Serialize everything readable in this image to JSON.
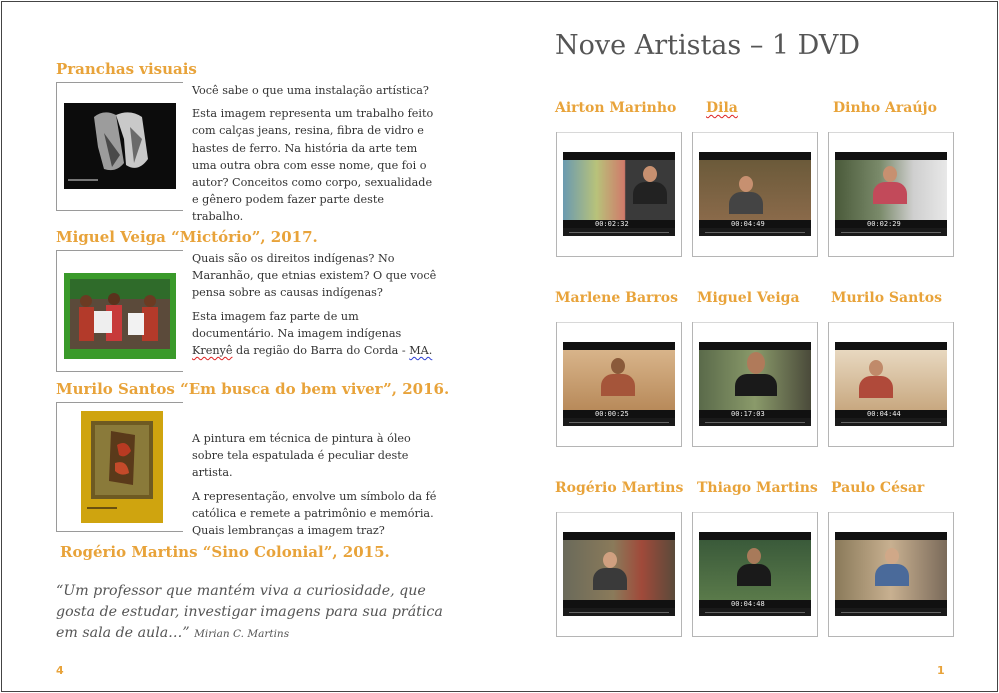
{
  "left_page": {
    "section1": {
      "heading": "Pranchas visuais",
      "p1": "Você sabe o que uma instalação artística?",
      "p2": "Esta imagem representa um trabalho feito com calças jeans, resina, fibra de vidro e hastes de ferro. Na história da arte tem uma outra obra com esse nome, que foi o autor? Conceitos como corpo, sexualidade e gênero podem fazer parte deste trabalho."
    },
    "section2": {
      "heading": "Miguel Veiga “Mictório”, 2017.",
      "p1": "Quais são os direitos indígenas? No Maranhão, que etnias existem? O que você pensa sobre as causas indígenas?",
      "p2_a": "Esta imagem faz parte de um documentário. Na imagem indígenas ",
      "p2_krenye": "Krenyê",
      "p2_b": " da região do Barra do Corda - ",
      "p2_ma": "MA."
    },
    "section3": {
      "heading": "Murilo Santos “Em busca do bem viver”, 2016.",
      "p1": "A pintura em técnica de pintura à óleo sobre tela espatulada é peculiar deste artista.",
      "p2": "A representação, envolve um símbolo da fé católica e remete a patrimônio e memória. Quais lembranças a imagem traz?"
    },
    "section4": {
      "heading": "Rogério Martins “Sino Colonial”, 2015."
    },
    "quote": {
      "text": "“Um professor que mantém viva a curiosidade, que gosta de estudar, investigar imagens para sua prática em sala de aula…”",
      "author": "Mirian C. Martins"
    },
    "page_number": "4"
  },
  "right_page": {
    "title": "Nove Artistas – 1 DVD",
    "artists": [
      {
        "name": "Airton Marinho",
        "timecode": "00:02:32"
      },
      {
        "name": "Dila",
        "timecode": "00:04:49"
      },
      {
        "name": "Dinho Araújo",
        "timecode": "00:02:29"
      },
      {
        "name": "Marlene Barros",
        "timecode": "00:00:25"
      },
      {
        "name": "Miguel Veiga",
        "timecode": "00:17:03"
      },
      {
        "name": "Murilo Santos",
        "timecode": "00:04:44"
      },
      {
        "name": "Rogério Martins",
        "timecode": ""
      },
      {
        "name": "Thiago Martins",
        "timecode": "00:04:48"
      },
      {
        "name": "Paulo César",
        "timecode": ""
      }
    ],
    "page_number": "1"
  },
  "colors": {
    "heading": "#e8a33a",
    "text": "#333333"
  }
}
